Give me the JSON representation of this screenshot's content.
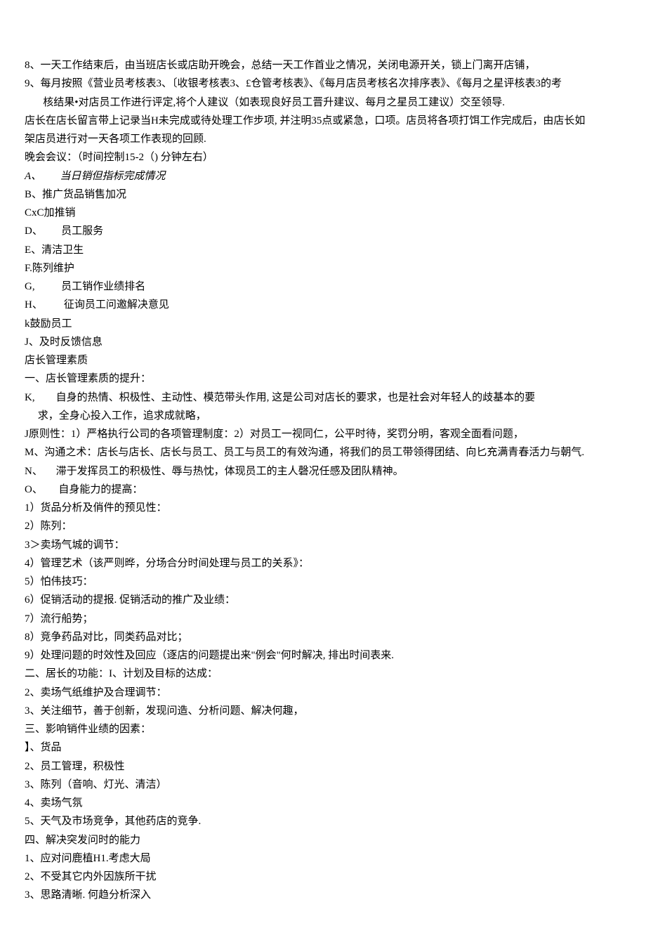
{
  "lines": [
    "8、一天工作结束后，由当班店长或店助开晚会，总结一天工作首业之情况，关闭电源开关，锁上门离开店铺，",
    "9、每月按照《营业员考核表3、〔收银考核表3、£仓管考核表》、《每月店员考核名次排序表》、《每月之星评核表3的考",
    "       核结果•对店员工作进行评定,将个人建议（如表现良好员工晋升建议、每月之星员工建议）交至领导.",
    "店长在店长留言带上记录当H未完成或待处理工作步项, 并注明35点或紧急，口项。店员将各项打饵工作完成后，由店长如",
    "架店员进行对一天各项工作表现的回顾.",
    "晚会会议：（时间控制15-2（) 分钟左右）",
    "A、       当日销但指标完成情况",
    "B、推广货品销售加况",
    "CxC加推销",
    "D、       员工服务",
    "E、清洁卫生",
    "F.陈列维护",
    "G,          员工销作业绩排名",
    "H、        征询员工问邀解决意见",
    "k鼓励员工",
    "J、及时反馈信息",
    "店长管理素质",
    "一、店长管理素质的提升：",
    "K,        自身的热情、枳极性、主动性、模范带头作用, 这是公司对店长的要求，也是社会对年轻人的歧基本的要",
    "     求，全身心投入工作，追求成就略，",
    "J原则性：1）严格执行公司的各项管理制度：2）对员工一视同仁，公平时待，奖罚分明，客观全面看问题，",
    "M、沟通之术：店长与店长、店长与员工、员工与员工的有效沟通，将我们的员工带领得团结、向匕充满青春活力与朝气.",
    "N、     滞于发挥员工的积极性、辱与热忱，体现员工的主人磬况任感及团队精神。",
    "O、      自身能力的提高：",
    "1）货品分析及俏件的预见性：",
    "2）陈列：",
    "3＞卖场气城的调节：",
    "4）管理艺术（该严则晔，分场合分时间处理与员工的关系》：",
    "5）怕伟技巧：",
    "6）促销活动的提报. 促销活动的推广及业绩：",
    "7）流行船势；",
    "8）竞争药品对比，同类药品对比；",
    "9）处理问题的时效性及回应（逐店的问题提出来\"例会\"何时解决, 排出时间表来.",
    "二、居长的功能：I、计划及目标的达成：",
    "2、卖场气纸维护及合理调节：",
    "3、关注细节，善于创新，发现问造、分析问题、解决何趣，",
    "三、影响销件业绩的因素：",
    "】、货品",
    "2、员工管理，积极性",
    "3、陈列（音响、灯光、清洁）",
    "4、卖场气氛",
    "5、天气及市场竞争，其他药店的竞争.",
    "四、解决突发问时的能力",
    "1、应对问鹿植H1.考虑大局",
    "2、不受其它内外因族所干扰",
    "3、思路清晰. 何趋分析深入"
  ]
}
